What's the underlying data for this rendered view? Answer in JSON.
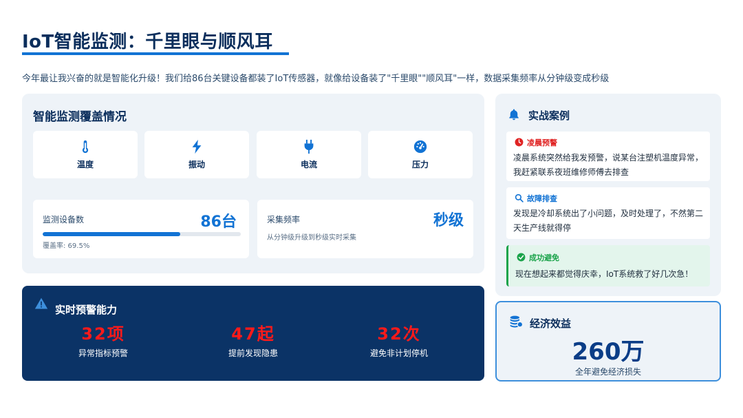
{
  "header": {
    "title": "IoT智能监测：千里眼与顺风耳",
    "subtitle": "今年最让我兴奋的就是智能化升级！我们给86台关键设备都装了IoT传感器，就像给设备装了\"千里眼\"\"顺风耳\"一样，数据采集频率从分钟级变成秒级"
  },
  "coverage": {
    "title": "智能监测覆盖情况",
    "sensors": [
      {
        "label": "温度",
        "icon": "thermometer-icon"
      },
      {
        "label": "振动",
        "icon": "bolt-icon"
      },
      {
        "label": "电流",
        "icon": "plug-icon"
      },
      {
        "label": "压力",
        "icon": "gauge-icon"
      }
    ],
    "devices": {
      "label": "监测设备数",
      "value": "86台",
      "coverage_text": "覆盖率: 69.5%",
      "coverage_fraction": 0.695
    },
    "frequency": {
      "label": "采集频率",
      "value": "秒级",
      "note": "从分钟级升级到秒级实时采集"
    }
  },
  "alerts": {
    "title": "实时预警能力",
    "metrics": [
      {
        "value": "32项",
        "label": "异常指标预警"
      },
      {
        "value": "47起",
        "label": "提前发现隐患"
      },
      {
        "value": "32次",
        "label": "避免非计划停机"
      }
    ]
  },
  "cases": {
    "title": "实战案例",
    "items": [
      {
        "tag": "凌晨预警",
        "text": "凌晨系统突然给我发预警，说某台注塑机温度异常，我赶紧联系夜班维修师傅去排查",
        "color": "#e02424"
      },
      {
        "tag": "故障排查",
        "text": "发现是冷却系统出了小问题，及时处理了，不然第二天生产线就得停",
        "color": "#1273d4"
      },
      {
        "tag": "成功避免",
        "text": "现在想起来都觉得庆幸，IoT系统救了好几次急！",
        "color": "#1aa34a"
      }
    ]
  },
  "economy": {
    "title": "经济效益",
    "value": "260万",
    "desc": "全年避免经济损失"
  },
  "colors": {
    "primary": "#1273d4",
    "navy": "#0b3366",
    "alert_red": "#ff1a1a",
    "success_green": "#1aa34a"
  }
}
